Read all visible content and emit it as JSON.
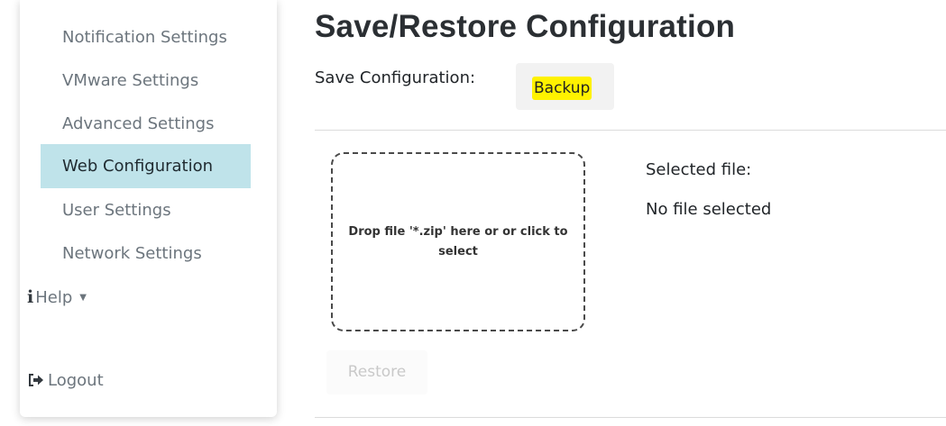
{
  "sidebar": {
    "items": [
      {
        "label": "Notification Settings"
      },
      {
        "label": "VMware Settings"
      },
      {
        "label": "Advanced Settings"
      },
      {
        "label": "Web Configuration",
        "active": true
      },
      {
        "label": "User Settings"
      },
      {
        "label": "Network Settings"
      }
    ],
    "help": {
      "label": "Help",
      "icon": "info-icon"
    },
    "logout": {
      "label": "Logout",
      "icon": "sign-out-icon"
    }
  },
  "main": {
    "title": "Save/Restore Configuration",
    "save_label": "Save Configuration:",
    "backup_button": "Backup",
    "dropzone_text": "Drop file '*.zip' here or or click to select",
    "selected_file_label": "Selected file:",
    "selected_file_value": "No file selected",
    "restore_button": "Restore"
  },
  "colors": {
    "active_item_bg": "#bfe3ea",
    "backup_highlight": "#fff200"
  }
}
